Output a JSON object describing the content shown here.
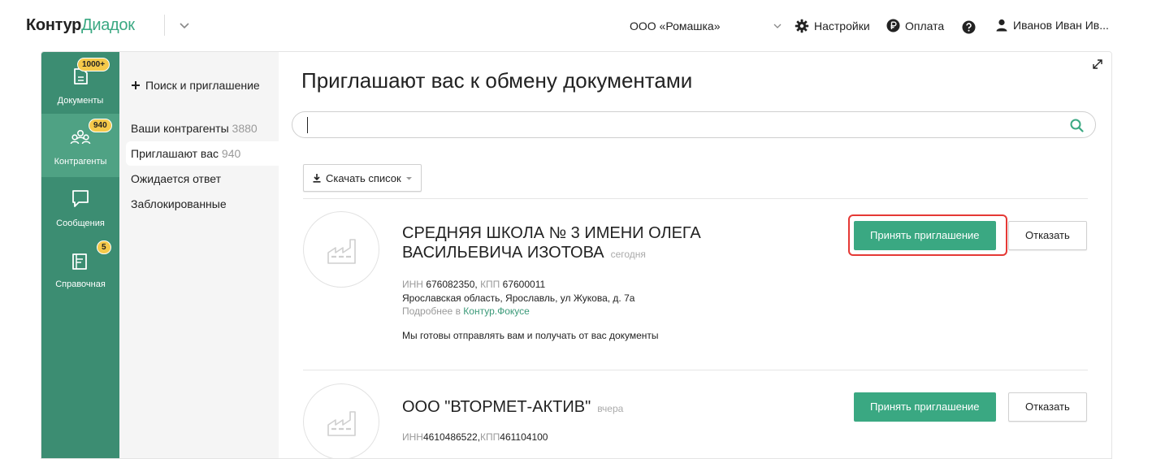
{
  "header": {
    "logo_brand": "Контур",
    "logo_product": "Диадок",
    "organization": "ООО «Ромашка»",
    "settings_label": "Настройки",
    "payment_label": "Оплата",
    "user_name": "Иванов Иван Ив...",
    "icons": [
      "chevron-down-icon",
      "gear-icon",
      "ruble-icon",
      "help-icon",
      "user-icon"
    ]
  },
  "leftnav": {
    "items": [
      {
        "label": "Документы",
        "badge": "1000+",
        "icon": "document-icon"
      },
      {
        "label": "Контрагенты",
        "badge": "940",
        "icon": "people-icon",
        "active": true
      },
      {
        "label": "Сообщения",
        "badge": "",
        "icon": "message-icon"
      },
      {
        "label": "Справочная",
        "badge": "5",
        "icon": "book-icon"
      }
    ]
  },
  "subnav": {
    "add_label": "Поиск и приглашение",
    "items": [
      {
        "label": "Ваши контрагенты",
        "count": "3880"
      },
      {
        "label": "Приглашают вас",
        "count": "940",
        "active": true
      },
      {
        "label": "Ожидается ответ",
        "count": ""
      },
      {
        "label": "Заблокированные",
        "count": ""
      }
    ]
  },
  "main": {
    "title": "Приглашают вас к обмену документами",
    "search": {
      "value": "",
      "placeholder": ""
    },
    "download_label": "Скачать список",
    "invitations": [
      {
        "name": "СРЕДНЯЯ ШКОЛА № 3 ИМЕНИ ОЛЕГА ВАСИЛЬЕВИЧА ИЗОТОВА",
        "when": "сегодня",
        "inn_label": "ИНН",
        "inn": "676082350,",
        "kpp_label": "КПП",
        "kpp": "67600011",
        "address": "Ярославская область, Ярославль, ул Жукова, д. 7а",
        "more_prefix": "Подробнее в",
        "more_link": "Контур.Фокусе",
        "message": "Мы готовы отправлять вам и получать от вас документы",
        "accept_label": "Принять приглашение",
        "reject_label": "Отказать"
      },
      {
        "name": "ООО \"ВТОРМЕТ-АКТИВ\"",
        "when": "вчера",
        "inn_label": "ИНН",
        "inn": "4610486522,",
        "kpp_label": "КПП",
        "kpp": "461104100",
        "accept_label": "Принять приглашение",
        "reject_label": "Отказать"
      }
    ]
  },
  "colors": {
    "accent": "#3aa882",
    "nav_bg": "#3c8d72",
    "nav_active": "#4fa284",
    "badge": "#f5c94a",
    "highlight": "#e53935"
  }
}
